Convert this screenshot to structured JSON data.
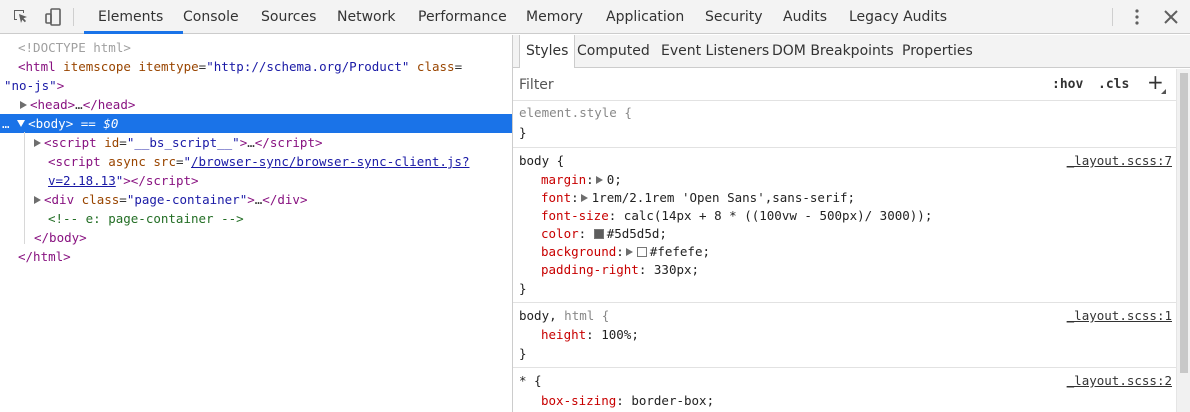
{
  "toolbar": {
    "tabs": [
      "Elements",
      "Console",
      "Sources",
      "Network",
      "Performance",
      "Memory",
      "Application",
      "Security",
      "Audits",
      "Legacy Audits"
    ],
    "active_tab": "Elements"
  },
  "dom": {
    "doctype": "<!DOCTYPE html>",
    "html_tag": "html",
    "html_attr1": "itemscope",
    "html_attr2": "itemtype",
    "html_attr2_val": "\"http://schema.org/Product\"",
    "html_attr3": "class",
    "html_attr3_val": "\"no-js\"",
    "head_open": "<head>",
    "ellipsis": "…",
    "head_close": "</head>",
    "body_open": "<body>",
    "body_marker": "== $0",
    "dots": "…",
    "script1_attr": "id",
    "script1_val": "\"__bs_script__\"",
    "script_tag": "script",
    "script2_attr1": "async",
    "script2_attr2": "src",
    "script2_src_a": "/browser-sync/browser-sync-client.js?",
    "script2_src_b": "v=2.18.13",
    "div_attr": "class",
    "div_val": "\"page-container\"",
    "div_tag": "div",
    "comment": "<!-- e: page-container -->",
    "body_close": "</body>",
    "html_close": "</html>"
  },
  "pane": {
    "tabs": [
      "Styles",
      "Computed",
      "Event Listeners",
      "DOM Breakpoints",
      "Properties"
    ],
    "active_tab": "Styles",
    "filter_placeholder": "Filter",
    "hov": ":hov",
    "cls": ".cls",
    "plus": "+"
  },
  "styles": {
    "element_style": "element.style {",
    "close": "}",
    "rule1": {
      "selector": "body {",
      "source": "_layout.scss:7",
      "props": [
        {
          "name": "margin",
          "value": "0;"
        },
        {
          "name": "font",
          "value": "1rem/2.1rem 'Open Sans',sans-serif;"
        },
        {
          "name": "font-size",
          "value": "calc(14px + 8 * ((100vw - 500px)/ 3000));"
        },
        {
          "name": "color",
          "value": "#5d5d5d;"
        },
        {
          "name": "background",
          "value": "#fefefe;"
        },
        {
          "name": "padding-right",
          "value": "330px;"
        }
      ]
    },
    "rule2": {
      "selector_a": "body,",
      "selector_b": "html {",
      "source": "_layout.scss:1",
      "prop_name": "height",
      "prop_value": "100%;"
    },
    "rule3": {
      "selector": "* {",
      "source": "_layout.scss:2",
      "prop_name": "box-sizing",
      "prop_value": "border-box;"
    }
  },
  "colors": {
    "accent": "#1a73e8",
    "swatch_color": "#5d5d5d",
    "swatch_background": "#fefefe"
  }
}
